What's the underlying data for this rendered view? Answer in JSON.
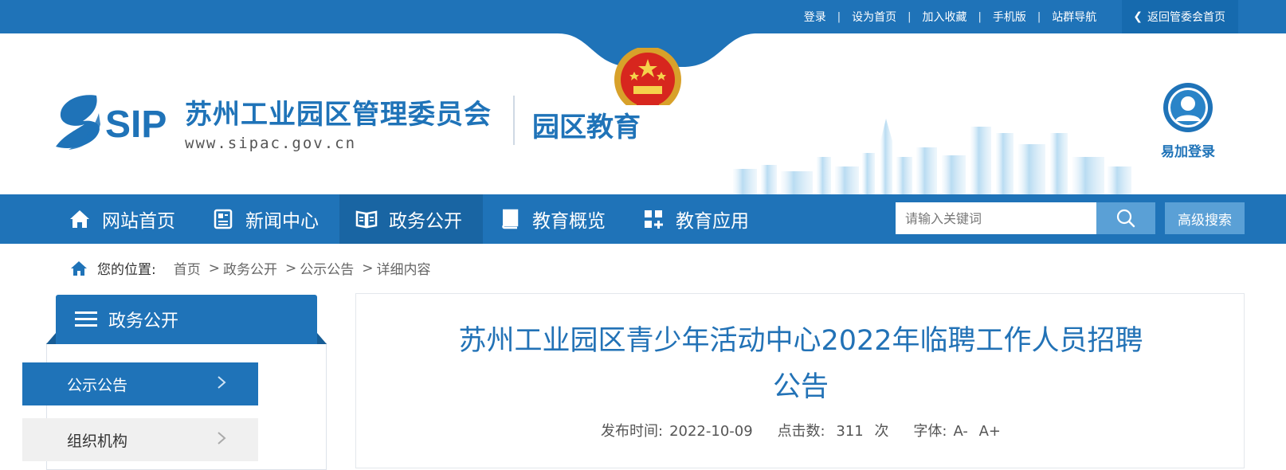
{
  "topbar": {
    "links": [
      "登录",
      "设为首页",
      "加入收藏",
      "手机版",
      "站群导航"
    ],
    "back_label": "返回管委会首页"
  },
  "header": {
    "org_mark": "SIP",
    "org_name": "苏州工业园区管理委员会",
    "org_url": "www.sipac.gov.cn",
    "section_name": "园区教育",
    "login_label": "易加登录"
  },
  "nav": {
    "items": [
      {
        "label": "网站首页",
        "icon": "home-icon"
      },
      {
        "label": "新闻中心",
        "icon": "news-icon"
      },
      {
        "label": "政务公开",
        "icon": "book-open-icon"
      },
      {
        "label": "教育概览",
        "icon": "book-icon"
      },
      {
        "label": "教育应用",
        "icon": "apps-icon"
      }
    ],
    "active_index": 2,
    "search_placeholder": "请输入关键词",
    "advanced_search_label": "高级搜索"
  },
  "breadcrumb": {
    "label": "您的位置:",
    "items": [
      "首页",
      "政务公开",
      "公示公告",
      "详细内容"
    ],
    "separator": ">"
  },
  "sidebar": {
    "title": "政务公开",
    "items": [
      {
        "label": "公示公告",
        "active": true
      },
      {
        "label": "组织机构",
        "active": false
      }
    ]
  },
  "article": {
    "title_line1": "苏州工业园区青少年活动中心2022年临聘工作人员招聘",
    "title_line2": "公告",
    "meta": {
      "date_label": "发布时间:",
      "date": "2022-10-09",
      "hits_label": "点击数:",
      "hits": "311",
      "hits_unit": "次",
      "font_label": "字体:",
      "font_smaller": "A-",
      "font_larger": "A+"
    }
  },
  "colors": {
    "brand_blue": "#1f73b8",
    "nav_active": "#1965a3",
    "search_button": "#5aa0d6"
  }
}
